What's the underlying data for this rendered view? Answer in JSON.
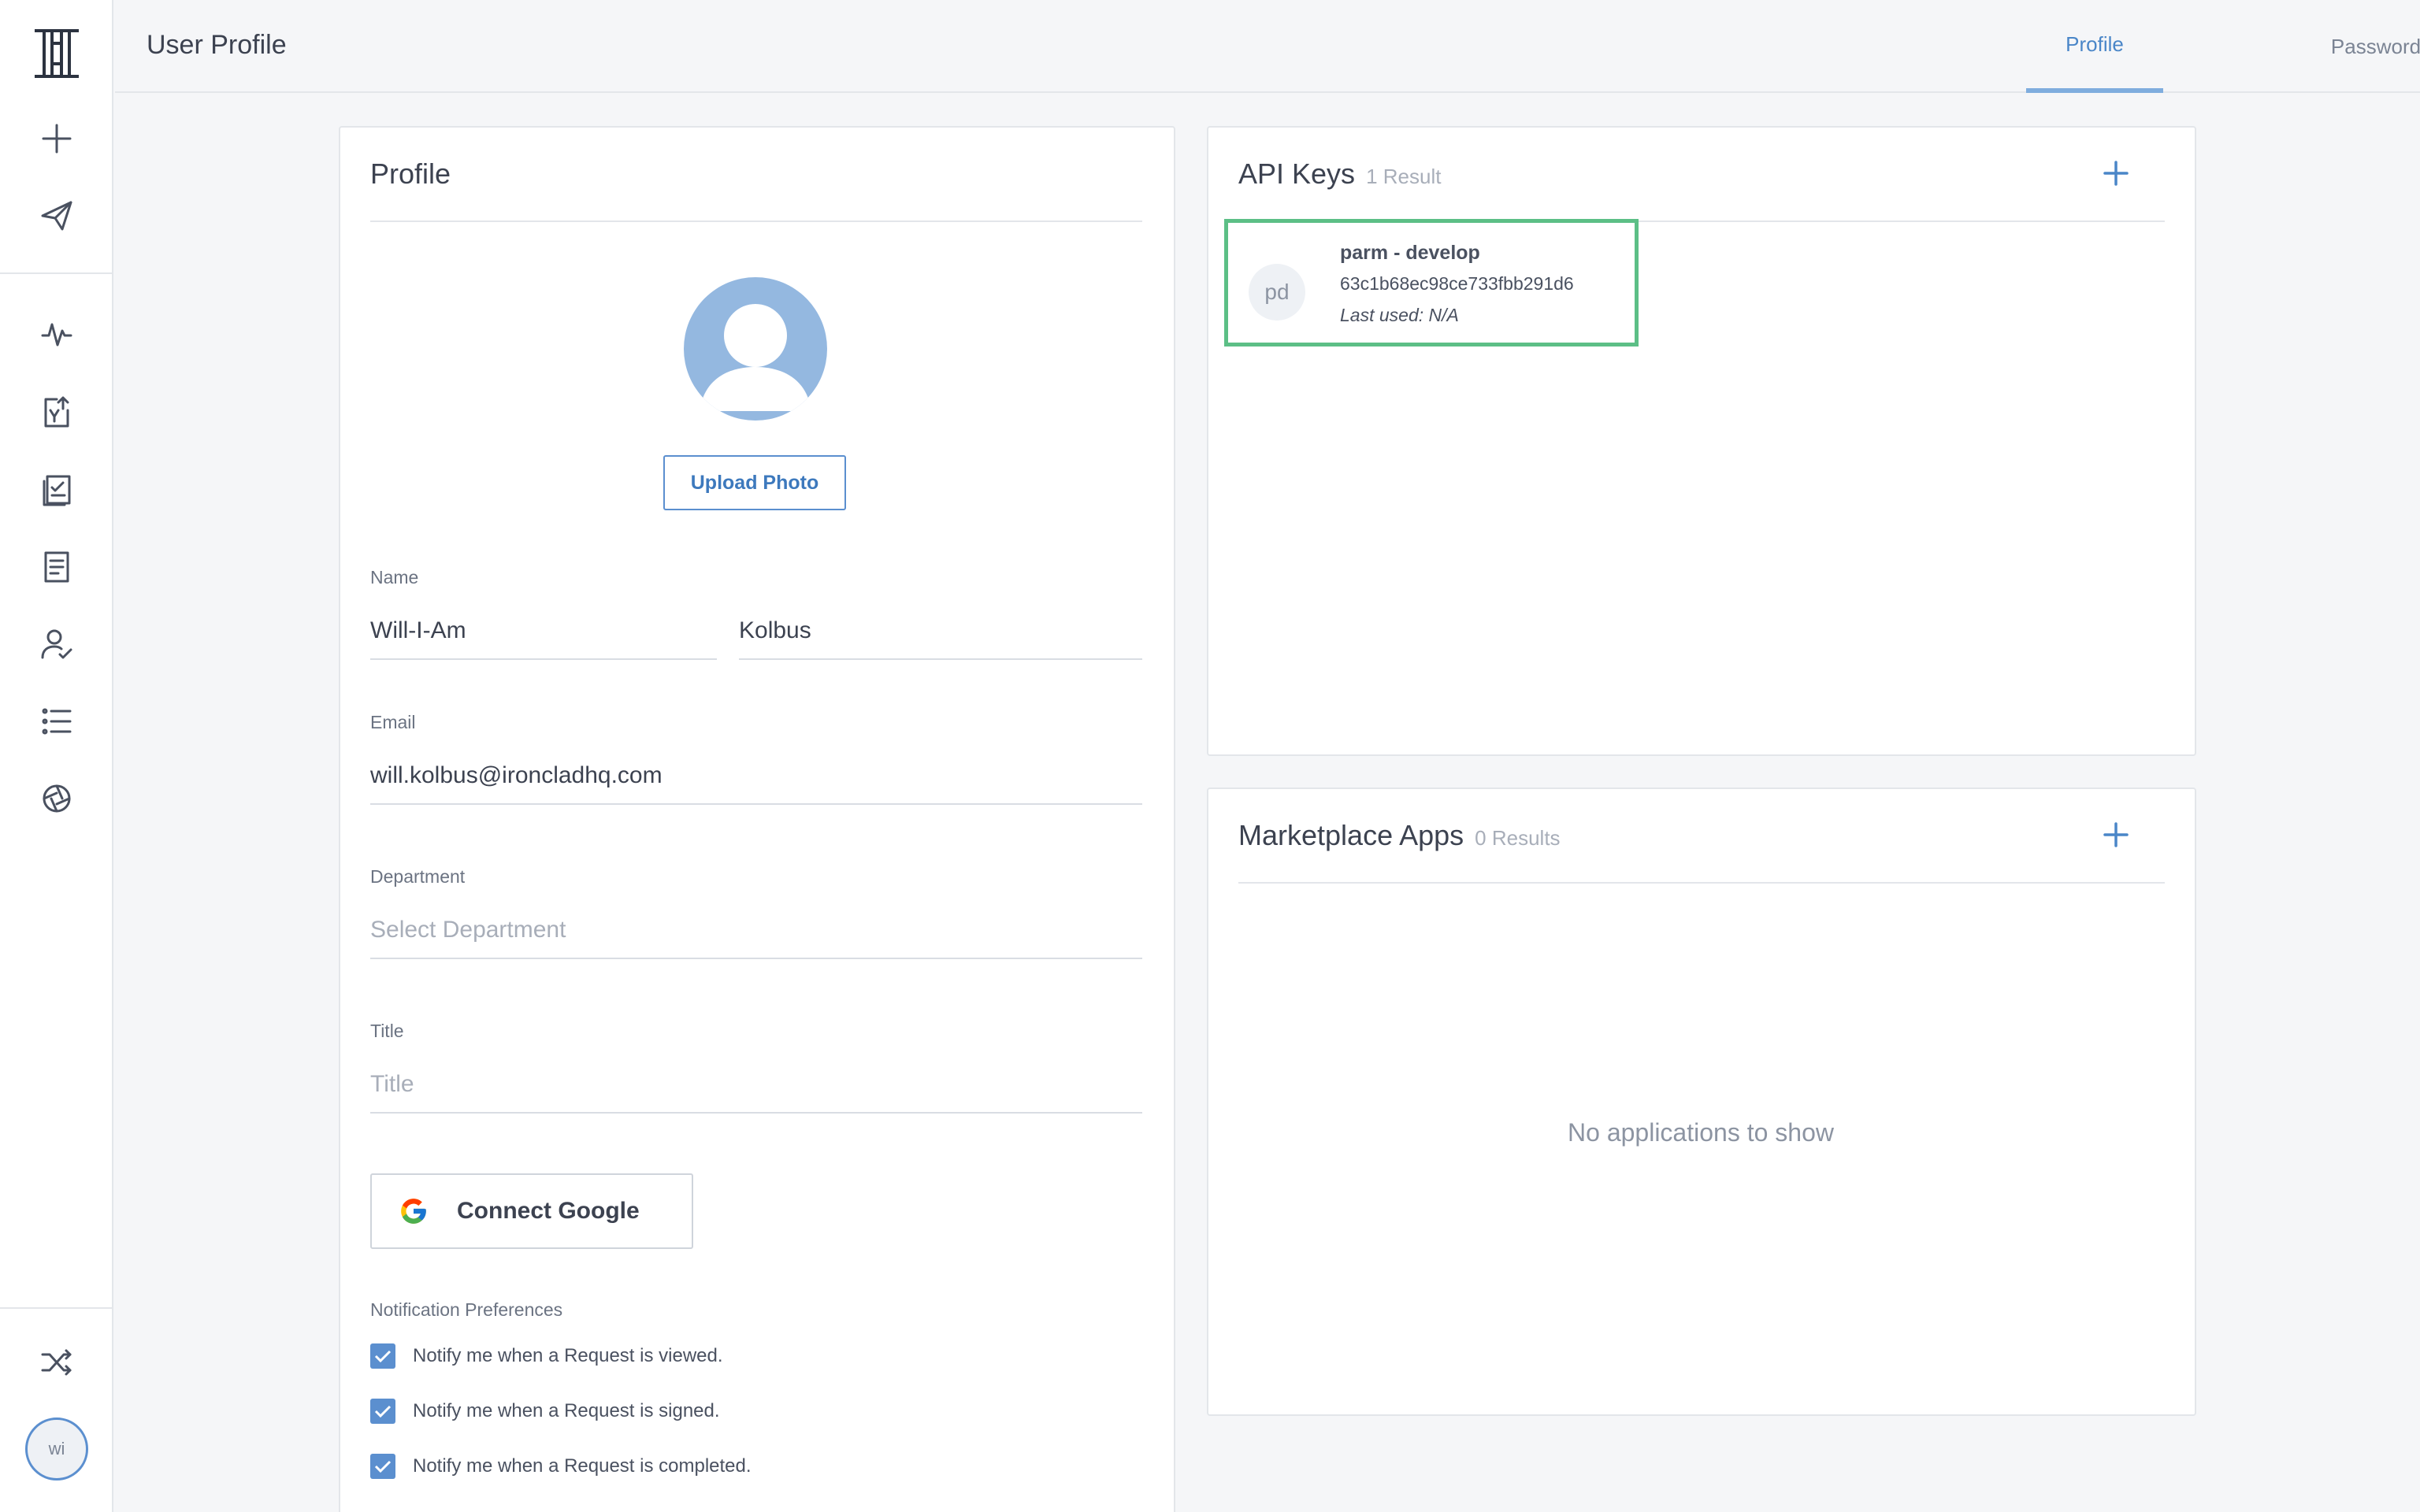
{
  "header": {
    "title": "User Profile"
  },
  "tabs": [
    {
      "label": "Profile",
      "active": true
    },
    {
      "label": "Password",
      "active": false
    }
  ],
  "sidebar": {
    "items": [
      {
        "icon": "logo-icon"
      },
      {
        "icon": "plus-icon"
      },
      {
        "icon": "send-icon"
      },
      {
        "icon": "activity-icon"
      },
      {
        "icon": "upload-document-icon"
      },
      {
        "icon": "checklist-document-icon"
      },
      {
        "icon": "document-icon"
      },
      {
        "icon": "user-check-icon"
      },
      {
        "icon": "list-icon"
      },
      {
        "icon": "aperture-icon"
      },
      {
        "icon": "shuffle-icon"
      }
    ],
    "user_initials": "wi"
  },
  "profile": {
    "title": "Profile",
    "upload_label": "Upload Photo",
    "name_label": "Name",
    "first_name": "Will-I-Am",
    "last_name": "Kolbus",
    "email_label": "Email",
    "email": "will.kolbus@ironcladhq.com",
    "department_label": "Department",
    "department_placeholder": "Select Department",
    "title_label": "Title",
    "title_placeholder": "Title",
    "google_label": "Connect Google",
    "notifications_label": "Notification Preferences",
    "notifications": [
      {
        "label": "Notify me when a Request is viewed.",
        "checked": true
      },
      {
        "label": "Notify me when a Request is signed.",
        "checked": true
      },
      {
        "label": "Notify me when a Request is completed.",
        "checked": true
      }
    ]
  },
  "api_keys": {
    "title": "API Keys",
    "count": "1 Result",
    "items": [
      {
        "initials": "pd",
        "name": "parm - develop",
        "key": "63c1b68ec98ce733fbb291d6",
        "last_used": "Last used: N/A"
      }
    ]
  },
  "marketplace": {
    "title": "Marketplace Apps",
    "count": "0 Results",
    "empty": "No applications to show"
  },
  "colors": {
    "accent": "#4a86c8",
    "highlight": "#5cbf86",
    "avatar": "#94b8e0"
  }
}
